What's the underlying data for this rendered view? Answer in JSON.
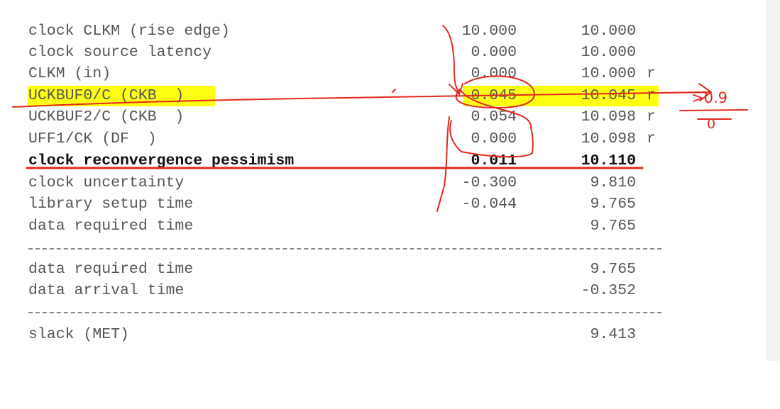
{
  "colors": {
    "text": "#555555",
    "bold_text": "#111111",
    "highlight": "#ffff14",
    "pen": "#e3291d"
  },
  "report": {
    "rows": [
      {
        "label": "clock CLKM (rise edge)",
        "incr": "10.000",
        "path": "10.000",
        "flag": ""
      },
      {
        "label": "clock source latency",
        "incr": "0.000",
        "path": "10.000",
        "flag": ""
      },
      {
        "label": "CLKM (in)",
        "incr": "0.000",
        "path": "10.000",
        "flag": "r"
      },
      {
        "label": "UCKBUF0/C (CKB  )",
        "incr": "0.045",
        "path": "10.045",
        "flag": "r"
      },
      {
        "label": "UCKBUF2/C (CKB  )",
        "incr": "0.054",
        "path": "10.098",
        "flag": "r"
      },
      {
        "label": "UFF1/CK (DF  )",
        "incr": "0.000",
        "path": "10.098",
        "flag": "r"
      },
      {
        "label": "clock reconvergence pessimism",
        "incr": "0.011",
        "path": "10.110",
        "flag": ""
      },
      {
        "label": "clock uncertainty",
        "incr": "-0.300",
        "path": "9.810",
        "flag": ""
      },
      {
        "label": "library setup time",
        "incr": "-0.044",
        "path": "9.765",
        "flag": ""
      },
      {
        "label": "data required time",
        "incr": "",
        "path": "9.765",
        "flag": ""
      }
    ],
    "summary": [
      {
        "label": "data required time",
        "path": "9.765"
      },
      {
        "label": "data arrival time",
        "path": "-0.352"
      }
    ],
    "slack": {
      "label": "slack (MET)",
      "path": "9.413"
    }
  },
  "annotations": {
    "handwritten_note": ">0.9",
    "handwritten_zero": "0"
  }
}
